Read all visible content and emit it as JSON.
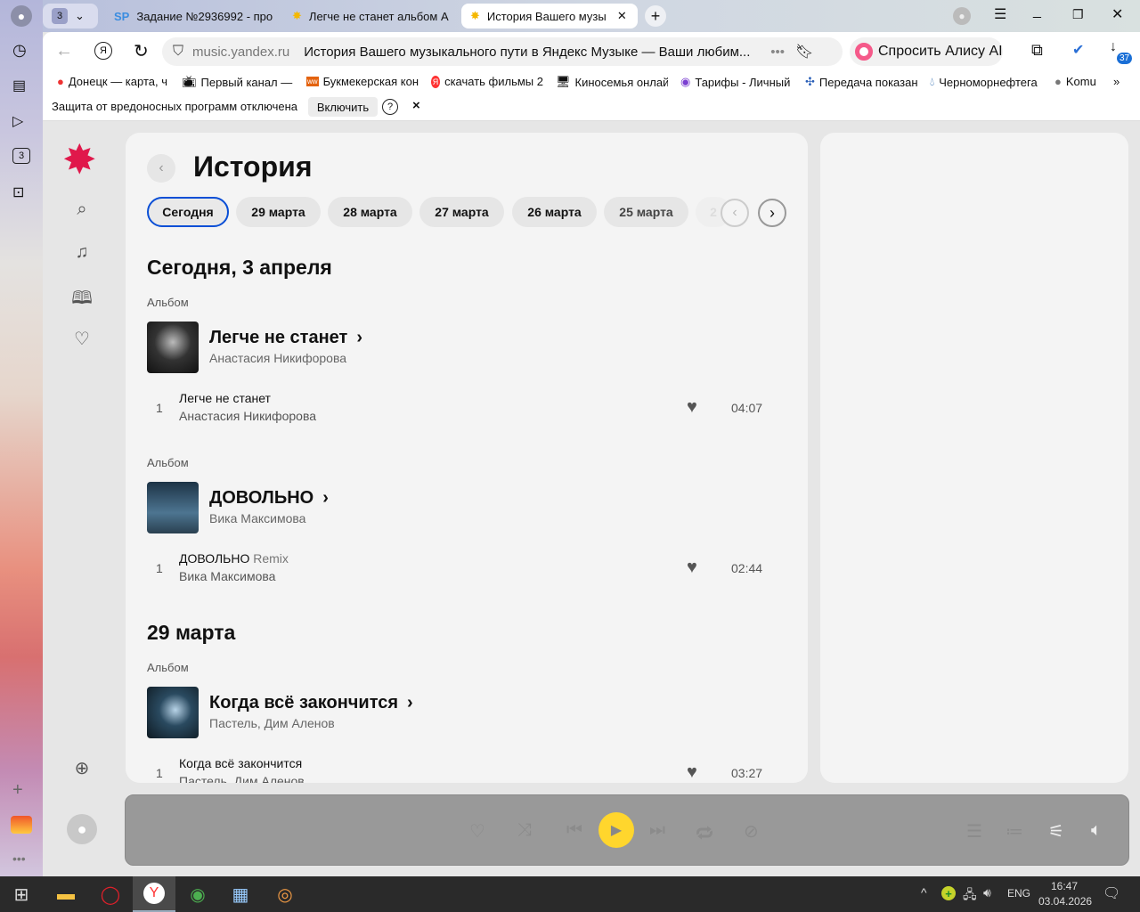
{
  "browser": {
    "tab_count": "3",
    "tabs": [
      {
        "title": "Задание №2936992 - про"
      },
      {
        "title": "Легче не станет альбом А"
      },
      {
        "title": "История Вашего музы"
      }
    ],
    "url_domain": "music.yandex.ru",
    "page_title": "История Вашего музыкального пути в Яндекс Музыке — Ваши любим...",
    "alice_label": "Спросить Алису AI",
    "downloads_badge": "37",
    "bookmarks": [
      "Донецк — карта, ч",
      "Первый канал — с",
      "Букмекерская кон",
      "скачать фильмы 2",
      "Киносемья онлай",
      "Тарифы - Личный",
      "Передача показан",
      "Черноморнефтега",
      "Komu"
    ],
    "infobar": {
      "message": "Защита от вредоносных программ отключена",
      "button": "Включить",
      "help": "?",
      "close": "×"
    },
    "left_panel_badge": "3"
  },
  "music": {
    "title": "История",
    "chips": [
      "Сегодня",
      "29 марта",
      "28 марта",
      "27 марта",
      "26 марта",
      "25 марта",
      "2"
    ],
    "sections": [
      {
        "heading": "Сегодня, 3 апреля",
        "albums": [
          {
            "label": "Альбом",
            "title": "Легче не станет",
            "artist": "Анастасия Никифорова",
            "track": {
              "n": "1",
              "title": "Легче не станет",
              "version": "",
              "artist": "Анастасия Никифорова",
              "duration": "04:07"
            }
          },
          {
            "label": "Альбом",
            "title": "ДОВОЛЬНО",
            "artist": "Вика Максимова",
            "track": {
              "n": "1",
              "title": "ДОВОЛЬНО",
              "version": "Remix",
              "artist": "Вика Максимова",
              "duration": "02:44"
            }
          }
        ]
      },
      {
        "heading": "29 марта",
        "albums": [
          {
            "label": "Альбом",
            "title": "Когда всё закончится",
            "artist": "Пастель, Дим Аленов",
            "track": {
              "n": "1",
              "title": "Когда всё закончится",
              "version": "",
              "artist": "Пастель, Дим Аленов",
              "duration": "03:27"
            }
          }
        ]
      }
    ],
    "colors": {
      "accent": "#ffd62d",
      "logo": "#e0184b",
      "chip_active_border": "#0a4fd6"
    }
  },
  "taskbar": {
    "lang": "ENG",
    "time": "16:47",
    "date": "03.04.2026"
  }
}
